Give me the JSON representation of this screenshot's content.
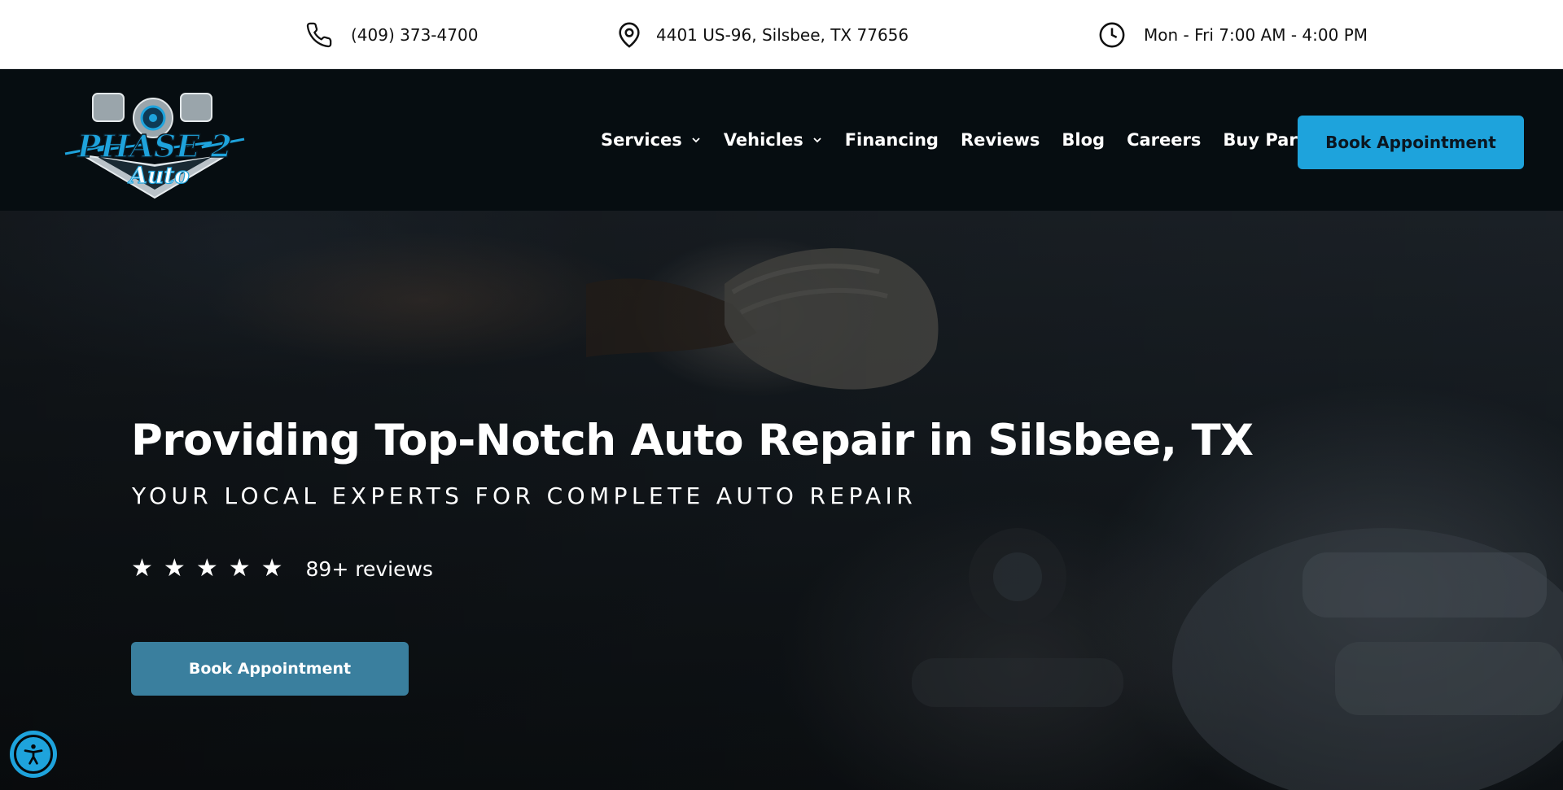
{
  "topbar": {
    "phone": "(409) 373-4700",
    "address": "4401 US-96, Silsbee, TX 77656",
    "hours": "Mon - Fri 7:00 AM - 4:00 PM"
  },
  "brand": {
    "logo_text_1": "PHASE 2",
    "logo_text_2": "Auto",
    "accent_color": "#1ea3dc"
  },
  "nav": {
    "items": [
      {
        "label": "Services",
        "has_dropdown": true
      },
      {
        "label": "Vehicles",
        "has_dropdown": true
      },
      {
        "label": "Financing",
        "has_dropdown": false
      },
      {
        "label": "Reviews",
        "has_dropdown": false
      },
      {
        "label": "Blog",
        "has_dropdown": false
      },
      {
        "label": "Careers",
        "has_dropdown": false
      },
      {
        "label": "Buy Parts",
        "has_dropdown": false
      }
    ],
    "cta_label": "Book Appointment"
  },
  "hero": {
    "title": "Providing Top-Notch Auto Repair in Silsbee, TX",
    "subtitle": "YOUR LOCAL EXPERTS FOR COMPLETE AUTO REPAIR",
    "rating_stars": 5,
    "reviews_text": "89+ reviews",
    "cta_label": "Book Appointment"
  },
  "icons": {
    "phone": "phone-icon",
    "address": "map-pin-icon",
    "hours": "clock-icon",
    "dropdown": "chevron-down-icon",
    "star": "star-icon",
    "accessibility": "accessibility-icon"
  }
}
